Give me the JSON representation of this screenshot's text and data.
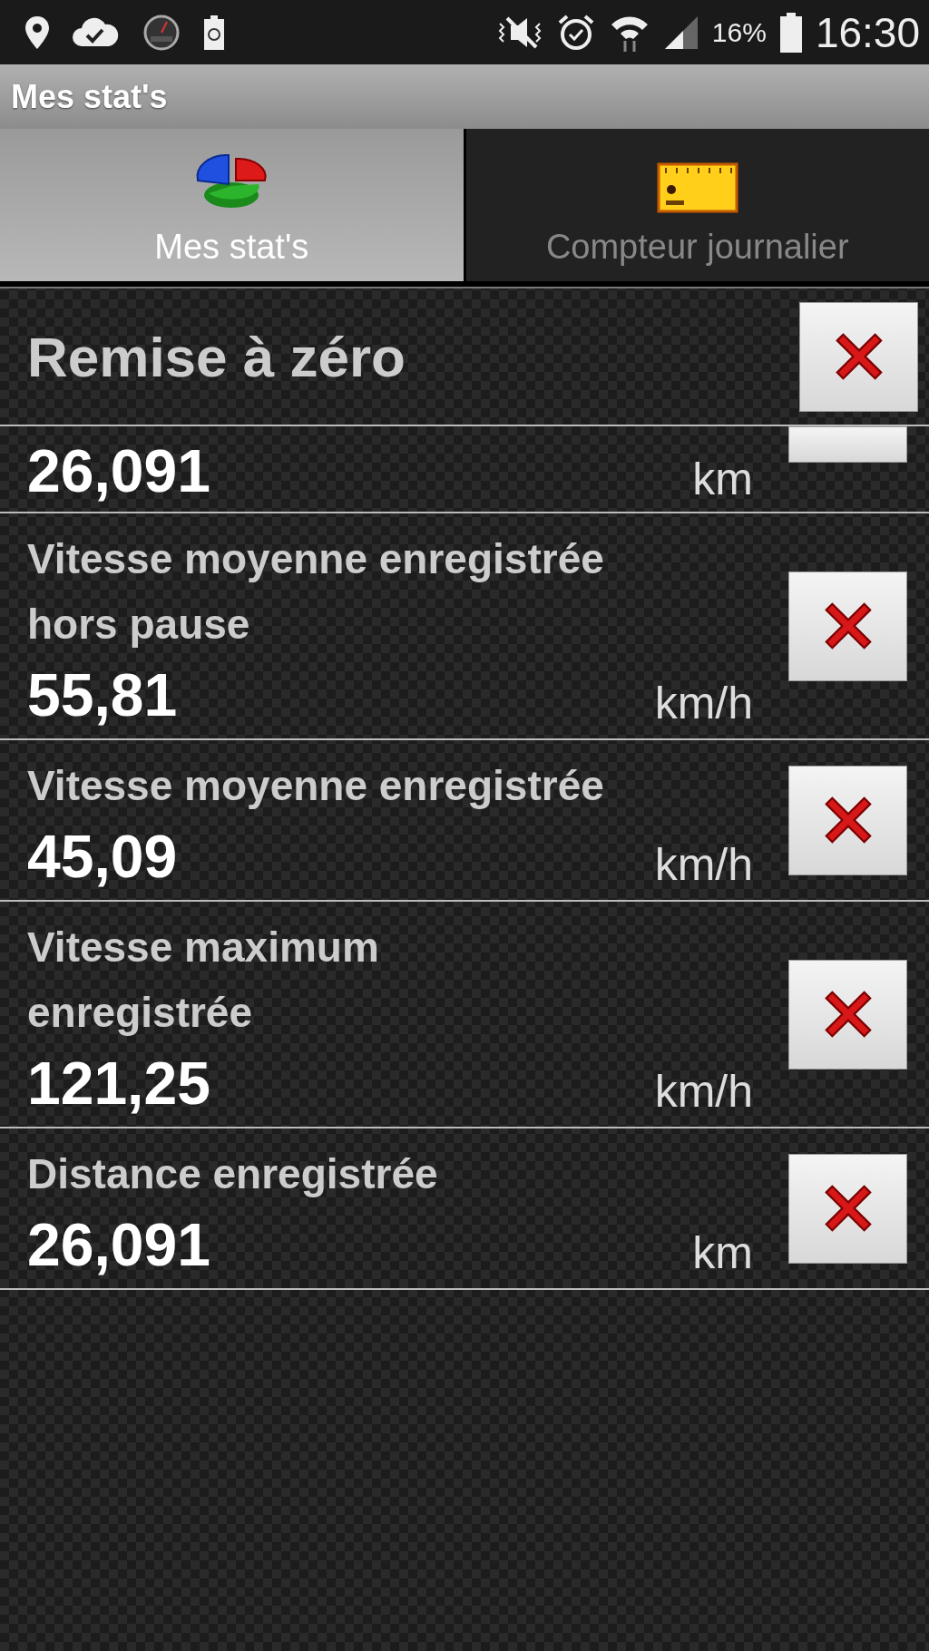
{
  "status_bar": {
    "battery": "16%",
    "time": "16:30"
  },
  "title": "Mes stat's",
  "tabs": [
    {
      "label": "Mes stat's",
      "selected": true,
      "kind": "pie"
    },
    {
      "label": "Compteur journalier",
      "selected": false,
      "kind": "ruler"
    }
  ],
  "reset": {
    "label": "Remise à zéro"
  },
  "stats": [
    {
      "kind": "partial",
      "value": "26,091",
      "unit": "km"
    },
    {
      "kind": "full",
      "label": "Vitesse moyenne enregistrée hors pause",
      "value": "55,81",
      "unit": "km/h"
    },
    {
      "kind": "full",
      "label": "Vitesse moyenne enregistrée",
      "value": "45,09",
      "unit": "km/h"
    },
    {
      "kind": "full",
      "label": "Vitesse maximum enregistrée",
      "value": "121,25",
      "unit": "km/h"
    },
    {
      "kind": "full",
      "label": "Distance enregistrée",
      "value": "26,091",
      "unit": "km"
    }
  ]
}
